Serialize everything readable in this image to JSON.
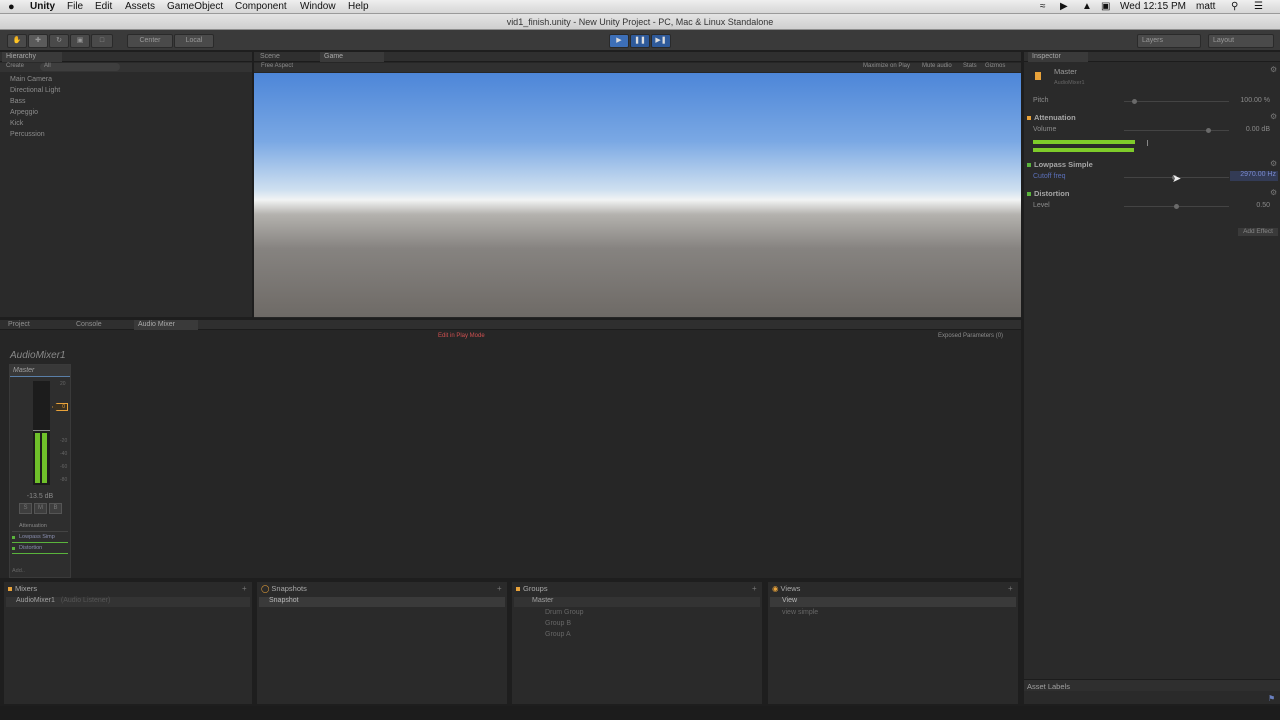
{
  "menubar": {
    "apple": "",
    "app": "Unity",
    "items": [
      "File",
      "Edit",
      "Assets",
      "GameObject",
      "Component",
      "Window",
      "Help"
    ],
    "title": "vid1_finish.unity - New Unity Project - PC, Mac & Linux Standalone",
    "clock": "Wed 12:15 PM",
    "user": "matt"
  },
  "toolbar": {
    "center": "Center",
    "local": "Local",
    "layers": "Layers",
    "layout": "Layout"
  },
  "hierarchy": {
    "tab": "Hierarchy",
    "create": "Create",
    "search_placeholder": "All",
    "items": [
      "Main Camera",
      "Directional Light",
      "Bass",
      "Arpeggio",
      "Kick",
      "Percussion"
    ]
  },
  "game": {
    "tab_scene": "Scene",
    "tab_game": "Game",
    "aspect": "Free Aspect",
    "options": [
      "Maximize on Play",
      "Mute audio",
      "Stats",
      "Gizmos"
    ]
  },
  "bottom": {
    "tabs": [
      "Project",
      "Console",
      "Audio Mixer"
    ],
    "edit_in_play": "Edit in Play Mode",
    "exposed": "Exposed Parameters (0)",
    "mixer_title": "AudioMixer1",
    "strip_name": "Master",
    "db_value": "-13.5 dB",
    "smb": [
      "S",
      "M",
      "B"
    ],
    "effects": [
      "Attenuation",
      "Lowpass Simp",
      "Distortion"
    ],
    "add": "Add..",
    "scale": [
      "20",
      "0",
      "-20",
      "-40",
      "-60",
      "-80"
    ],
    "fader_marker": "0"
  },
  "mixers_panel": {
    "mixers": {
      "title": "Mixers",
      "item": "AudioMixer1",
      "item_note": "(Audio Listener)"
    },
    "snapshots": {
      "title": "Snapshots",
      "item": "Snapshot"
    },
    "groups": {
      "title": "Groups",
      "root": "Master",
      "children": [
        "Drum Group",
        "Group B",
        "Group A"
      ]
    },
    "views": {
      "title": "Views",
      "items": [
        "View",
        "view simple"
      ]
    }
  },
  "inspector": {
    "tab": "Inspector",
    "object": "Master",
    "subtitle": "AudioMixer1",
    "pitch_label": "Pitch",
    "pitch_value": "100.00 %",
    "attenuation": {
      "title": "Attenuation",
      "volume_label": "Volume",
      "volume_value": "0.00 dB"
    },
    "lowpass": {
      "title": "Lowpass Simple",
      "cutoff_label": "Cutoff freq",
      "cutoff_value": "2970.00 Hz"
    },
    "distortion": {
      "title": "Distortion",
      "level_label": "Level",
      "level_value": "0.50"
    },
    "add_effect": "Add Effect",
    "asset_labels": "Asset Labels"
  },
  "colors": {
    "accent_orange": "#e8a23a",
    "meter_green": "#7ecb2a",
    "effect_green": "#5ab43c",
    "sky_top": "#5a8ed8"
  }
}
